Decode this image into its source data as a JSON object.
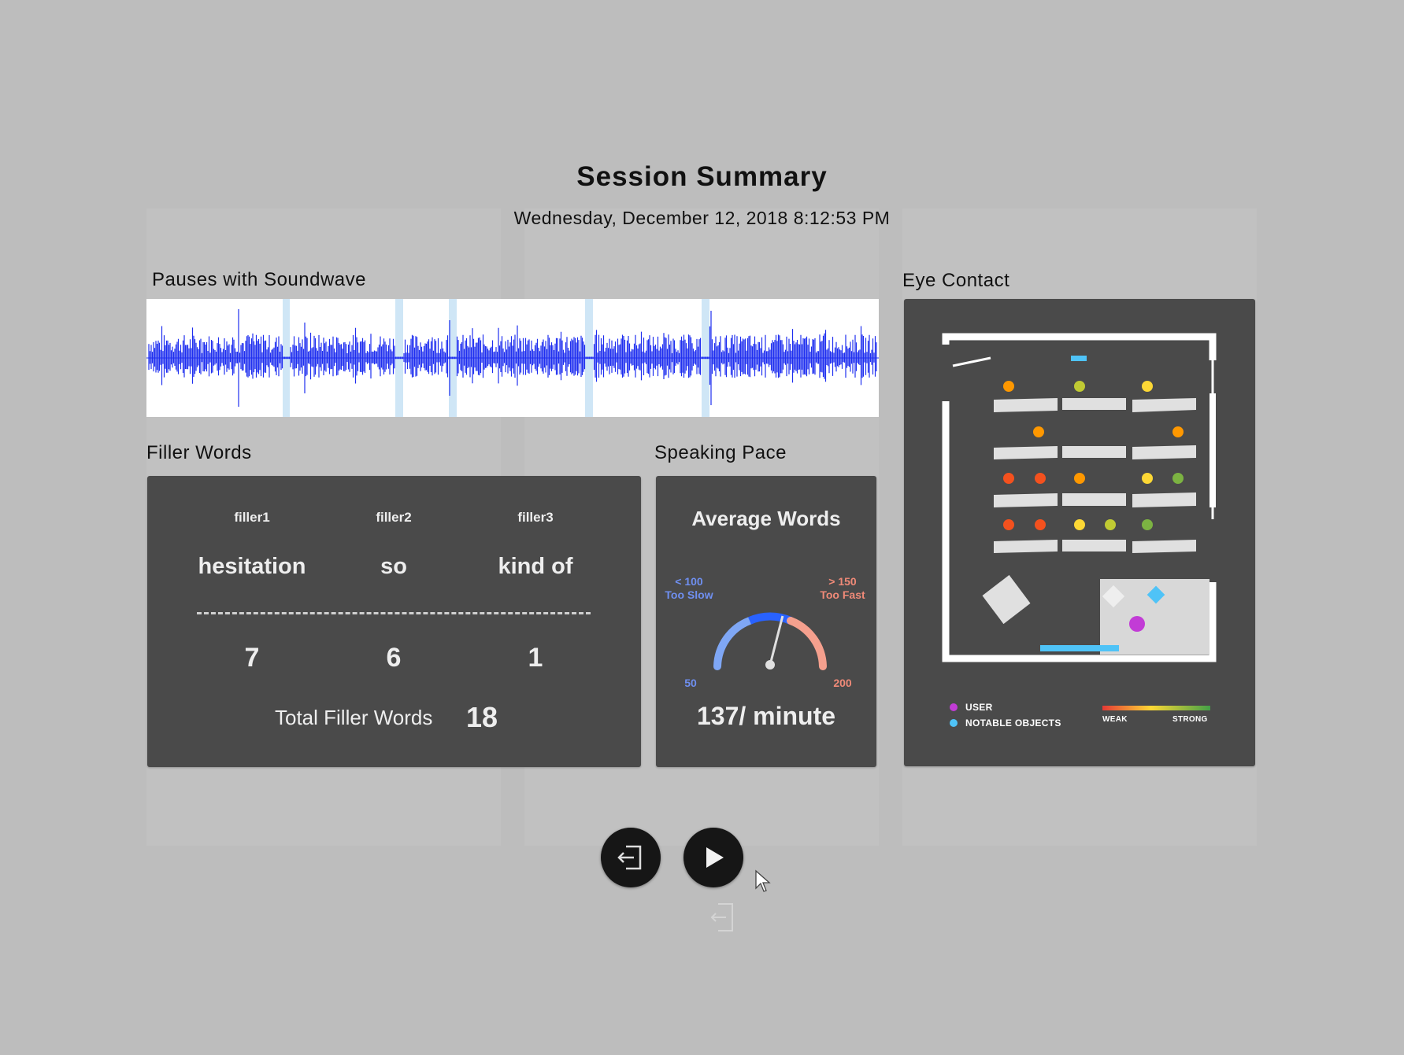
{
  "header": {
    "title": "Session Summary",
    "datetime": "Wednesday, December 12, 2018 8:12:53 PM"
  },
  "sections": {
    "pauses": "Pauses with Soundwave",
    "eye_contact": "Eye Contact",
    "filler_words": "Filler Words",
    "speaking_pace": "Speaking Pace"
  },
  "filler": {
    "items": [
      {
        "header": "filler1",
        "word": "hesitation",
        "count": "7"
      },
      {
        "header": "filler2",
        "word": "so",
        "count": "6"
      },
      {
        "header": "filler3",
        "word": "kind of",
        "count": "1"
      }
    ],
    "total_label": "Total Filler Words",
    "total_value": "18"
  },
  "pace": {
    "title": "Average Words",
    "slow_range": "< 100",
    "slow_label": "Too Slow",
    "fast_range": "> 150",
    "fast_label": "Too Fast",
    "min": "50",
    "max": "200",
    "value": 137,
    "value_text": "137/ minute"
  },
  "eye_contact": {
    "legend": {
      "user": "USER",
      "objects": "NOTABLE OBJECTS",
      "weak": "WEAK",
      "strong": "STRONG"
    },
    "colors": {
      "user": "#c23cd6",
      "objects": "#4fc3f7",
      "red": "#f4511e",
      "orange": "#ff9800",
      "yellow": "#fdd835",
      "lime": "#c0ca33",
      "green": "#43a047"
    }
  },
  "controls": {
    "exit_icon": "exit-door-icon",
    "play_icon": "play-icon"
  },
  "colors": {
    "background": "#bdbdbd",
    "panel": "#4a4a4a",
    "waveform": "#1f2ff0",
    "pause_marker": "#cfe6f6",
    "gauge_slow": "#7fa7f5",
    "gauge_ok": "#2962ff",
    "gauge_fast": "#f5a08e"
  }
}
